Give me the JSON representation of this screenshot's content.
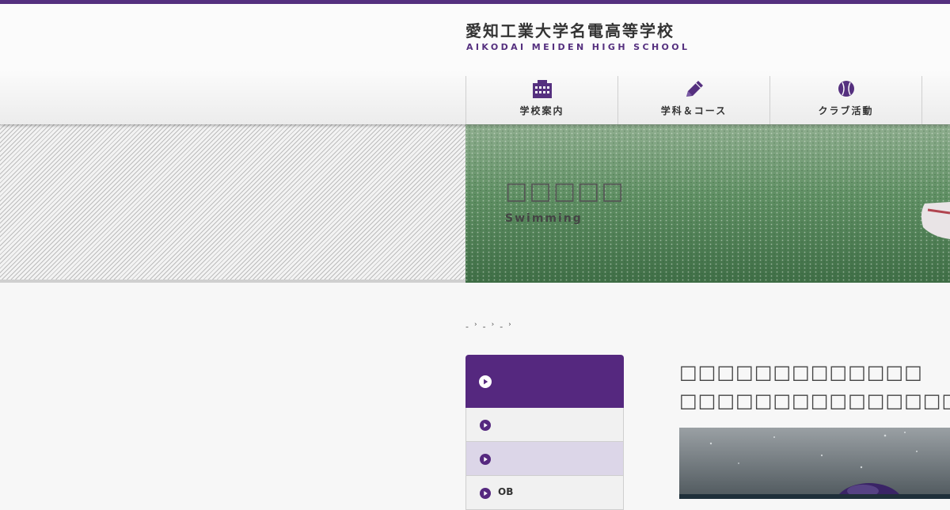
{
  "site": {
    "logo_jp": "愛知工業大学名電高等学校",
    "logo_en": "AIKODAI MEIDEN HIGH SCHOOL"
  },
  "nav": [
    {
      "label": "学校案内",
      "icon": "building-icon"
    },
    {
      "label": "学科＆コース",
      "icon": "pencil-icon"
    },
    {
      "label": "クラブ活動",
      "icon": "baseball-icon"
    }
  ],
  "hero": {
    "title": "□□□□□",
    "subtitle": "Swimming"
  },
  "breadcrumb": [
    "-",
    "-",
    "-"
  ],
  "sidemenu": {
    "items": [
      {
        "label": ""
      },
      {
        "label": ""
      },
      {
        "label": "OB"
      }
    ]
  },
  "article": {
    "title_line1": "□□□□□□□□□□□□□",
    "title_line2": "□□□□□□□□□□□□□□□□"
  },
  "colors": {
    "brand_purple": "#55307f",
    "menu_active": "#dcd6e8"
  }
}
